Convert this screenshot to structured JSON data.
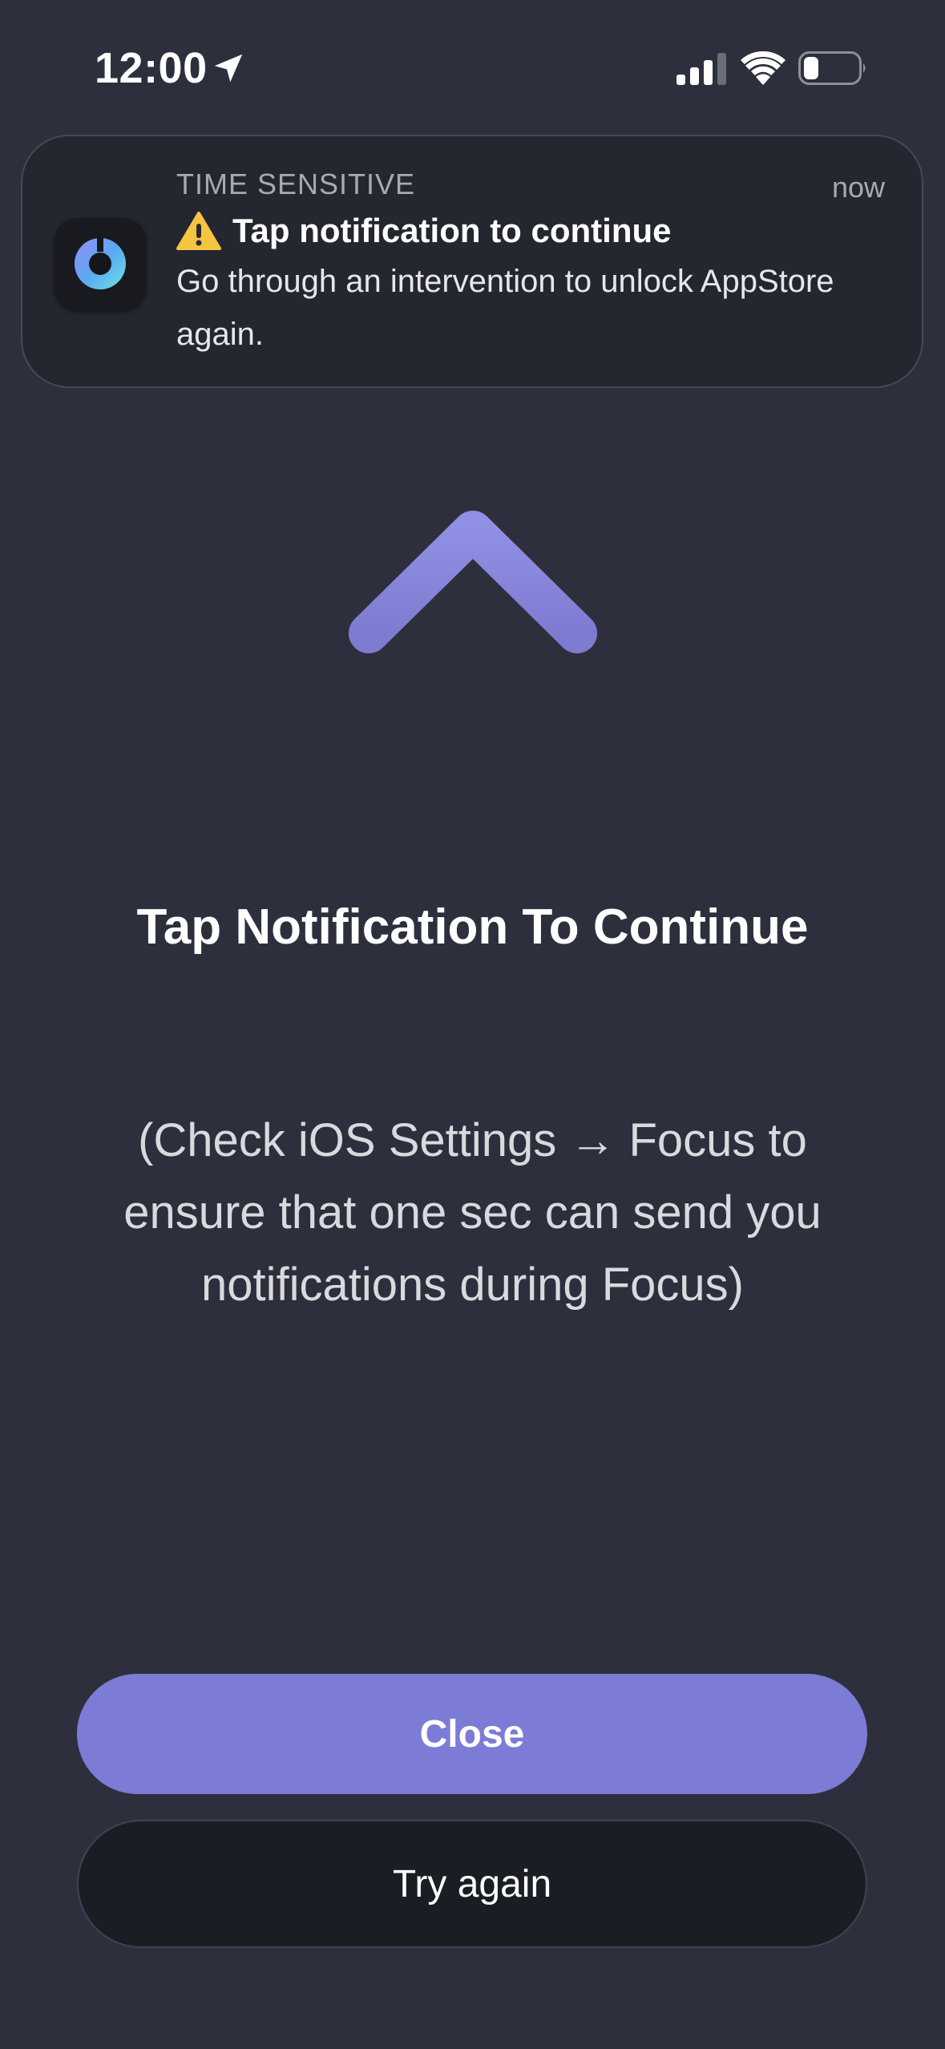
{
  "status_bar": {
    "time": "12:00",
    "icons": [
      "location-arrow-icon",
      "cellular-signal-icon",
      "wifi-icon",
      "battery-icon"
    ]
  },
  "notification": {
    "app_icon": "one-sec-app-icon",
    "category": "TIME SENSITIVE",
    "time": "now",
    "warning_icon": "warning-icon",
    "title": "Tap notification to continue",
    "body": "Go through an intervention to unlock AppStore again."
  },
  "main": {
    "arrow_icon": "up-arrow-icon",
    "heading": "Tap Notification To Continue",
    "hint": "(Check iOS Settings → Focus to ensure that one sec can send you notifications during Focus)"
  },
  "buttons": {
    "close_label": "Close",
    "try_again_label": "Try again"
  },
  "colors": {
    "background": "#2d303c",
    "accent": "#7c7cd6",
    "secondary_button": "#1b1d25",
    "notification_bg": "#242630"
  }
}
